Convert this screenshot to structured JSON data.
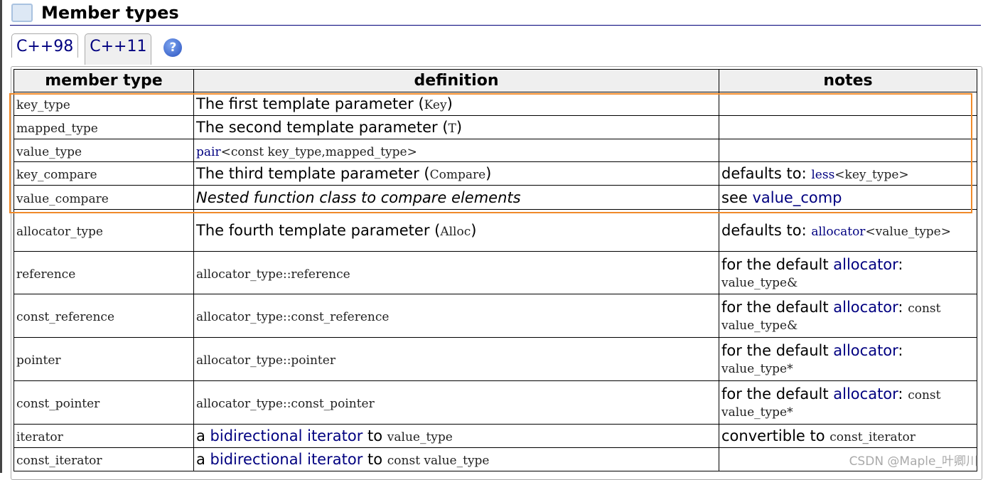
{
  "section_title": "Member types",
  "tabs": [
    "C++98",
    "C++11"
  ],
  "help_icon": "?",
  "headers": [
    "member type",
    "definition",
    "notes"
  ],
  "rows": [
    {
      "type": "key_type",
      "def": [
        {
          "t": "The first template parameter ("
        },
        {
          "t": "Key",
          "s": "code"
        },
        {
          "t": ")"
        }
      ],
      "notes": []
    },
    {
      "type": "mapped_type",
      "def": [
        {
          "t": "The second template parameter ("
        },
        {
          "t": "T",
          "s": "code"
        },
        {
          "t": ")"
        }
      ],
      "notes": []
    },
    {
      "type": "value_type",
      "def": [
        {
          "t": "pair",
          "s": "code link"
        },
        {
          "t": "<const key_type,mapped_type>",
          "s": "code"
        }
      ],
      "notes": []
    },
    {
      "type": "key_compare",
      "def": [
        {
          "t": "The third template parameter ("
        },
        {
          "t": "Compare",
          "s": "code"
        },
        {
          "t": ")"
        }
      ],
      "notes": [
        {
          "t": "defaults to: "
        },
        {
          "t": "less",
          "s": "code link"
        },
        {
          "t": "<key_type>",
          "s": "code"
        }
      ]
    },
    {
      "type": "value_compare",
      "def": [
        {
          "t": "Nested function class to compare elements",
          "s": "italic"
        }
      ],
      "notes": [
        {
          "t": "see "
        },
        {
          "t": "value_comp",
          "s": "link"
        }
      ]
    },
    {
      "type": "allocator_type",
      "def": [
        {
          "t": "The fourth template parameter ("
        },
        {
          "t": "Alloc",
          "s": "code"
        },
        {
          "t": ")"
        }
      ],
      "notes": [
        {
          "t": "defaults to: "
        },
        {
          "t": "allocator",
          "s": "code link"
        },
        {
          "t": "<value_type>",
          "s": "code"
        }
      ]
    },
    {
      "type": "reference",
      "def": [
        {
          "t": "allocator_type::reference",
          "s": "code"
        }
      ],
      "notes": [
        {
          "t": "for the default "
        },
        {
          "t": "allocator",
          "s": "link"
        },
        {
          "t": ": "
        },
        {
          "t": "value_type&",
          "s": "code"
        }
      ]
    },
    {
      "type": "const_reference",
      "def": [
        {
          "t": "allocator_type::const_reference",
          "s": "code"
        }
      ],
      "notes": [
        {
          "t": "for the default "
        },
        {
          "t": "allocator",
          "s": "link"
        },
        {
          "t": ": "
        },
        {
          "t": "const value_type&",
          "s": "code"
        }
      ]
    },
    {
      "type": "pointer",
      "def": [
        {
          "t": "allocator_type::pointer",
          "s": "code"
        }
      ],
      "notes": [
        {
          "t": "for the default "
        },
        {
          "t": "allocator",
          "s": "link"
        },
        {
          "t": ": "
        },
        {
          "t": "value_type*",
          "s": "code"
        }
      ]
    },
    {
      "type": "const_pointer",
      "def": [
        {
          "t": "allocator_type::const_pointer",
          "s": "code"
        }
      ],
      "notes": [
        {
          "t": "for the default "
        },
        {
          "t": "allocator",
          "s": "link"
        },
        {
          "t": ": "
        },
        {
          "t": "const value_type*",
          "s": "code"
        }
      ]
    },
    {
      "type": "iterator",
      "def": [
        {
          "t": "a "
        },
        {
          "t": "bidirectional iterator",
          "s": "link"
        },
        {
          "t": " to "
        },
        {
          "t": "value_type",
          "s": "code"
        }
      ],
      "notes": [
        {
          "t": "convertible to "
        },
        {
          "t": "const_iterator",
          "s": "code"
        }
      ]
    },
    {
      "type": "const_iterator",
      "def": [
        {
          "t": "a "
        },
        {
          "t": "bidirectional iterator",
          "s": "link"
        },
        {
          "t": " to "
        },
        {
          "t": "const value_type",
          "s": "code"
        }
      ],
      "notes": []
    }
  ],
  "watermark": "CSDN @Maple_叶卿川"
}
